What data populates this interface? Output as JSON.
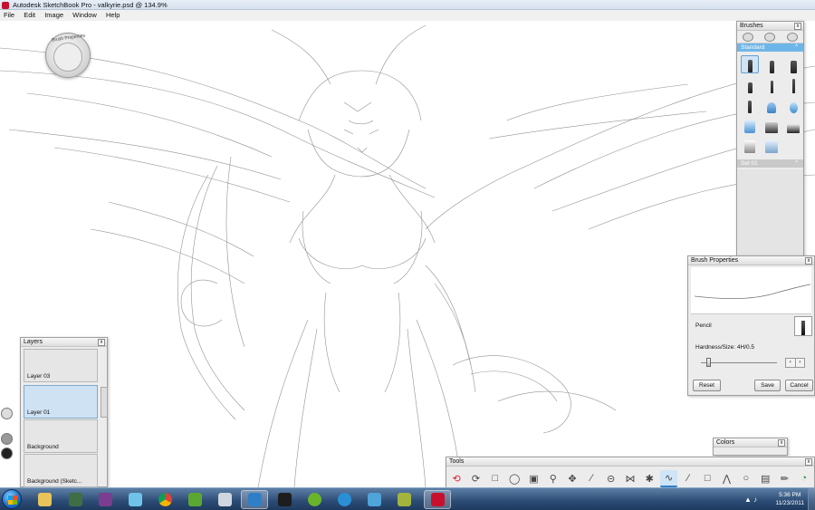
{
  "window": {
    "title": "Autodesk SketchBook Pro - valkyrie.psd @ 134.9%"
  },
  "menu": {
    "items": [
      "File",
      "Edit",
      "Image",
      "Window",
      "Help"
    ]
  },
  "lagoon": {
    "label": "Brush Properties"
  },
  "brushes_panel": {
    "title": "Brushes",
    "close": "x",
    "tabs": [
      "brush-library-icon",
      "brush-sets-icon",
      "brush-settings-icon"
    ],
    "set1": "Standard",
    "set2": "Set 01",
    "caret": "^",
    "tools": [
      "pencil-icon",
      "ink-pen-icon",
      "marker-icon",
      "felt-pen-icon",
      "ballpoint-icon",
      "fine-pen-icon",
      "brush-pen-icon",
      "airbrush-icon",
      "water-drop-icon",
      "triangle-brush-icon",
      "smudge-icon",
      "eraser-hard-icon",
      "paint-bucket-icon",
      "blender-icon"
    ]
  },
  "brush_properties": {
    "title": "Brush Properties",
    "close": "x",
    "brush_name": "Pencil",
    "hardness_label": "Hardness/Size: 4H/0.5",
    "hardness_value": 0.1,
    "reset": "Reset",
    "save": "Save",
    "cancel": "Cancel"
  },
  "layers": {
    "title": "Layers",
    "close": "x",
    "items": [
      {
        "name": "Layer 03"
      },
      {
        "name": "Layer 01"
      },
      {
        "name": "Background"
      },
      {
        "name": "Background (Sketc..."
      }
    ]
  },
  "colors": {
    "title": "Colors",
    "close": "x"
  },
  "tools_panel": {
    "title": "Tools",
    "close": "x",
    "items": [
      "undo-icon",
      "redo-icon",
      "rect-select-icon",
      "lasso-icon",
      "crop-icon",
      "zoom-icon",
      "move-icon",
      "ruler-icon",
      "ellipse-guide-icon",
      "symmetry-x-icon",
      "symmetry-y-icon",
      "curve-icon",
      "line-icon",
      "rectangle-icon",
      "polyline-icon",
      "circle-icon",
      "text-icon",
      "brush-icon",
      "color-wheel-icon"
    ]
  },
  "taskbar": {
    "apps": [
      "file-explorer-icon",
      "monitor-icon",
      "winrar-icon",
      "dice-game-icon",
      "chrome-icon",
      "people-icon",
      "steam-icon",
      "display-icon",
      "book-icon",
      "utorrent-icon",
      "itunes-icon",
      "photos-icon",
      "controller-icon",
      "sketchbook-icon"
    ],
    "time": "5:36 PM",
    "date": "11/23/2011"
  }
}
